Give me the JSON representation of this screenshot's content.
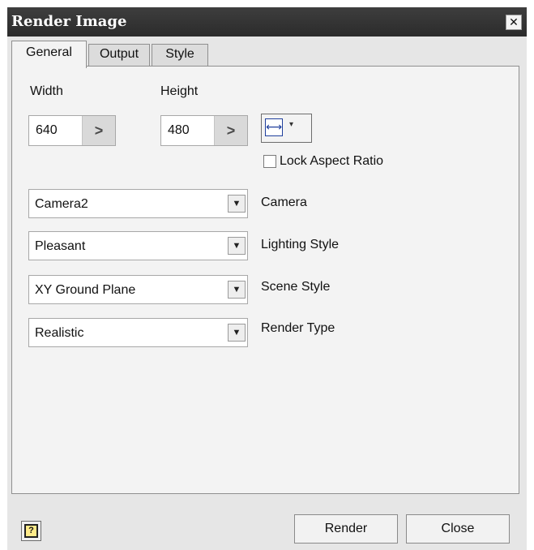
{
  "window": {
    "title": "Render Image",
    "close_glyph": "✕"
  },
  "tabs": [
    {
      "label": "General",
      "active": true
    },
    {
      "label": "Output",
      "active": false
    },
    {
      "label": "Style",
      "active": false
    }
  ],
  "size": {
    "width_label": "Width",
    "width_value": "640",
    "height_label": "Height",
    "height_value": "480",
    "arrow_glyph": ">",
    "aspect_icon": "⟷",
    "caret": "▾"
  },
  "lock_aspect": {
    "label": "Lock Aspect Ratio",
    "checked": false
  },
  "dropdowns": [
    {
      "value": "Camera2",
      "label": "Camera"
    },
    {
      "value": "Pleasant",
      "label": "Lighting Style"
    },
    {
      "value": "XY Ground Plane",
      "label": "Scene Style"
    },
    {
      "value": "Realistic",
      "label": "Render Type"
    }
  ],
  "dropdown_glyph": "▼",
  "footer": {
    "help_glyph": "?",
    "render_label": "Render",
    "close_label": "Close"
  },
  "icons": [
    "close-icon",
    "chevron-right-icon",
    "width-height-icon",
    "chevron-down-icon",
    "help-icon"
  ]
}
